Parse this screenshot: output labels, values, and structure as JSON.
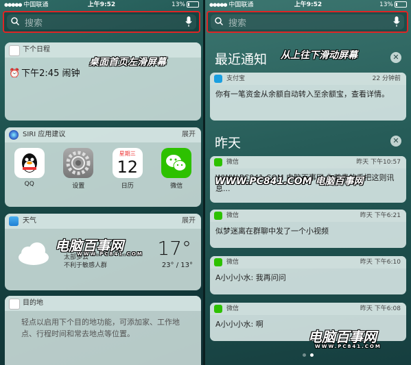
{
  "status": {
    "carrier": "中国联通",
    "time": "上午9:52",
    "battery": "13%"
  },
  "search": {
    "placeholder": "搜索"
  },
  "left": {
    "annotation": "桌面首页左滑屏幕",
    "calendar": {
      "header": "下个日程",
      "event": "下午2:45 闹钟"
    },
    "siri": {
      "header": "SIRI 应用建议",
      "more": "展开",
      "apps": [
        {
          "name": "QQ"
        },
        {
          "name": "设置"
        },
        {
          "name": "日历",
          "weekday": "星期三",
          "day": "12"
        },
        {
          "name": "微信"
        }
      ]
    },
    "weather": {
      "header": "天气",
      "more": "展开",
      "condition_line1": "多云",
      "condition_line2": "太部多云",
      "condition_line3": "不利于敏感人群",
      "temp": "17°",
      "range": "23° / 13°"
    },
    "destination": {
      "header": "目的地",
      "body": "轻点以启用下个目的地功能，可添加家、工作地点、行程时间和常去地点等位置。"
    }
  },
  "right": {
    "annotation": "从上往下滑动屏幕",
    "recent_title": "最近通知",
    "yesterday_title": "昨天",
    "close_symbol": "✕",
    "notifications_recent": [
      {
        "app": "支付宝",
        "time": "22 分钟前",
        "body": "你有一笔资金从余额自动转入至余额宝，查看详情。"
      }
    ],
    "notifications_yesterday": [
      {
        "app": "微信",
        "time": "昨天 下午10:57",
        "body": "WWW.PC841.COM 电脑百事网 你尊贵的手把这则讯息..."
      },
      {
        "app": "微信",
        "time": "昨天 下午6:21",
        "body": "似梦迷离在群聊中发了一个小视频"
      },
      {
        "app": "微信",
        "time": "昨天 下午6:10",
        "body": "A小小小水: 我再问问"
      },
      {
        "app": "微信",
        "time": "昨天 下午6:08",
        "body": "A小小小水: 啊"
      }
    ]
  },
  "watermarks": {
    "brand": "电脑百事网",
    "url": "WWW.PC841.COM",
    "site": "WWW.PC841.COM"
  },
  "colors": {
    "highlight": "#e02424",
    "wechat": "#2dc100",
    "alipay": "#1a9fe0"
  }
}
